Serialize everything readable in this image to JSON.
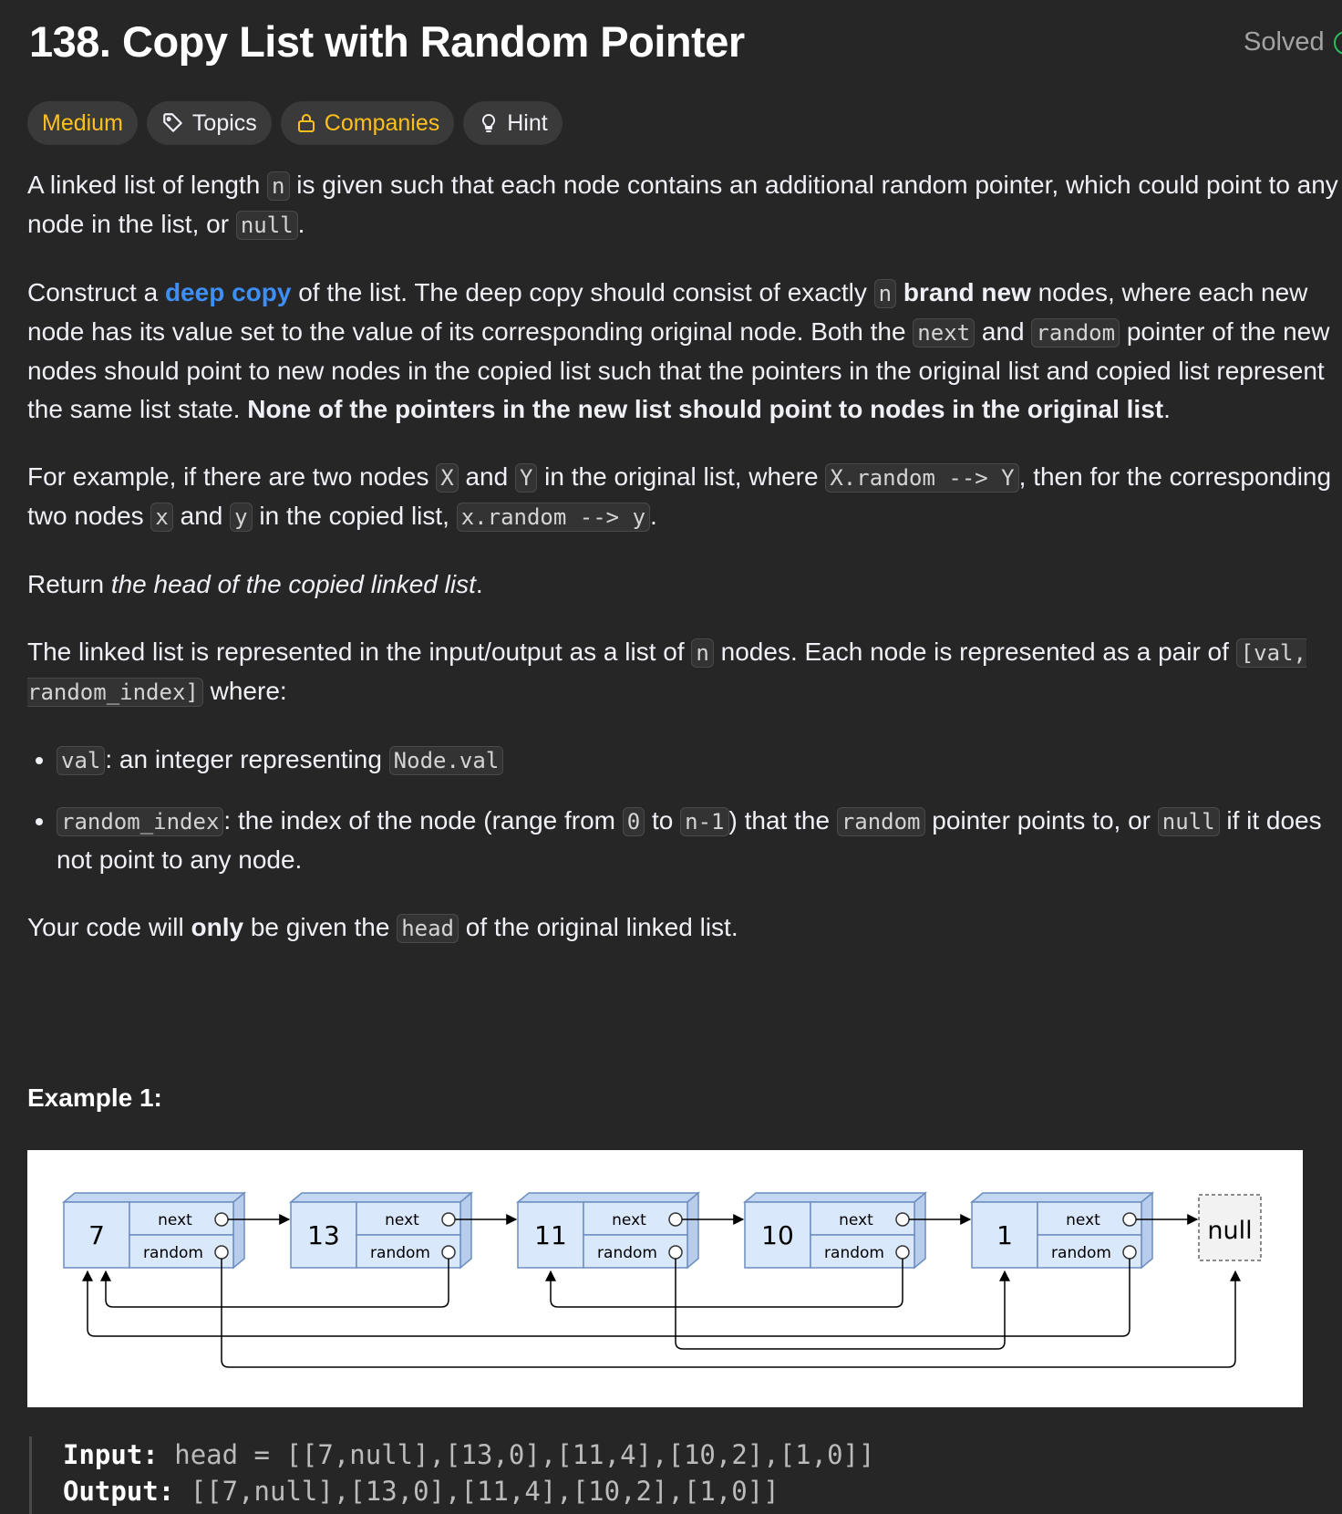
{
  "problem": {
    "title": "138. Copy List with Random Pointer",
    "status": "Solved"
  },
  "chips": {
    "difficulty": "Medium",
    "topics": "Topics",
    "companies": "Companies",
    "hint": "Hint"
  },
  "description": {
    "p1": {
      "t1": "A linked list of length ",
      "c1": "n",
      "t2": " is given such that each node contains an additional random pointer, which could point to any node in the list, or ",
      "c2": "null",
      "t3": "."
    },
    "p2": {
      "t1": "Construct a ",
      "link": "deep copy",
      "t2": " of the list. The deep copy should consist of exactly ",
      "c1": "n",
      "t3": " ",
      "b1": "brand new",
      "t4": " nodes, where each new node has its value set to the value of its corresponding original node. Both the ",
      "c2": "next",
      "t5": " and ",
      "c3": "random",
      "t6": " pointer of the new nodes should point to new nodes in the copied list such that the pointers in the original list and copied list represent the same list state. ",
      "b2": "None of the pointers in the new list should point to nodes in the original list",
      "t7": "."
    },
    "p3": {
      "t1": "For example, if there are two nodes ",
      "c1": "X",
      "t2": " and ",
      "c2": "Y",
      "t3": " in the original list, where ",
      "c3": "X.random --> Y",
      "t4": ", then for the corresponding two nodes ",
      "c4": "x",
      "t5": " and ",
      "c5": "y",
      "t6": " in the copied list, ",
      "c6": "x.random --> y",
      "t7": "."
    },
    "p4": {
      "t1": "Return ",
      "i1": "the head of the copied linked list",
      "t2": "."
    },
    "p5": {
      "t1": "The linked list is represented in the input/output as a list of ",
      "c1": "n",
      "t2": " nodes. Each node is represented as a pair of ",
      "c2": "[val, random_index]",
      "t3": " where:"
    },
    "bullets": {
      "b1": {
        "c1": "val",
        "t1": ": an integer representing ",
        "c2": "Node.val"
      },
      "b2": {
        "c1": "random_index",
        "t1": ": the index of the node (range from ",
        "c2": "0",
        "t2": " to ",
        "c3": "n-1",
        "t3": ") that the ",
        "c4": "random",
        "t4": " pointer points to, or ",
        "c5": "null",
        "t5": " if it does not point to any node."
      }
    },
    "p6": {
      "t1": "Your code will ",
      "b1": "only",
      "t2": " be given the ",
      "c1": "head",
      "t3": " of the original linked list."
    }
  },
  "example": {
    "title": "Example 1:",
    "diagram": {
      "nodes": [
        "7",
        "13",
        "11",
        "10",
        "1"
      ],
      "next_label": "next",
      "random_label": "random",
      "null_label": "null",
      "random_targets": [
        null,
        0,
        4,
        2,
        0
      ]
    },
    "input_label": "Input:",
    "input_value": "head = [[7,null],[13,0],[11,4],[10,2],[1,0]]",
    "output_label": "Output:",
    "output_value": "[[7,null],[13,0],[11,4],[10,2],[1,0]]"
  },
  "colors": {
    "background": "#262626",
    "difficulty": "#ffc01e",
    "link": "#3e8ef7",
    "solved_check": "#2cbb5d",
    "node_fill": "#dae8fc",
    "node_stroke": "#6c8ebf"
  }
}
